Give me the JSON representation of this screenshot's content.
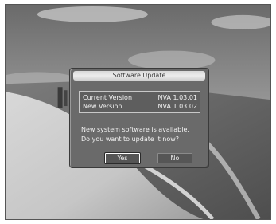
{
  "dialog": {
    "title": "Software Update",
    "versions": [
      {
        "label": "Current Version",
        "value": "NVA 1.03.01"
      },
      {
        "label": "New Version",
        "value": "NVA 1.03.02"
      }
    ],
    "message_line1": "New system software is available.",
    "message_line2": "Do you want to update it now?",
    "buttons": {
      "yes": "Yes",
      "no": "No"
    }
  },
  "colors": {
    "dialog_bg": "#6a6a6a",
    "title_bar": "#e0e0e0",
    "text": "#f2f2f2"
  }
}
